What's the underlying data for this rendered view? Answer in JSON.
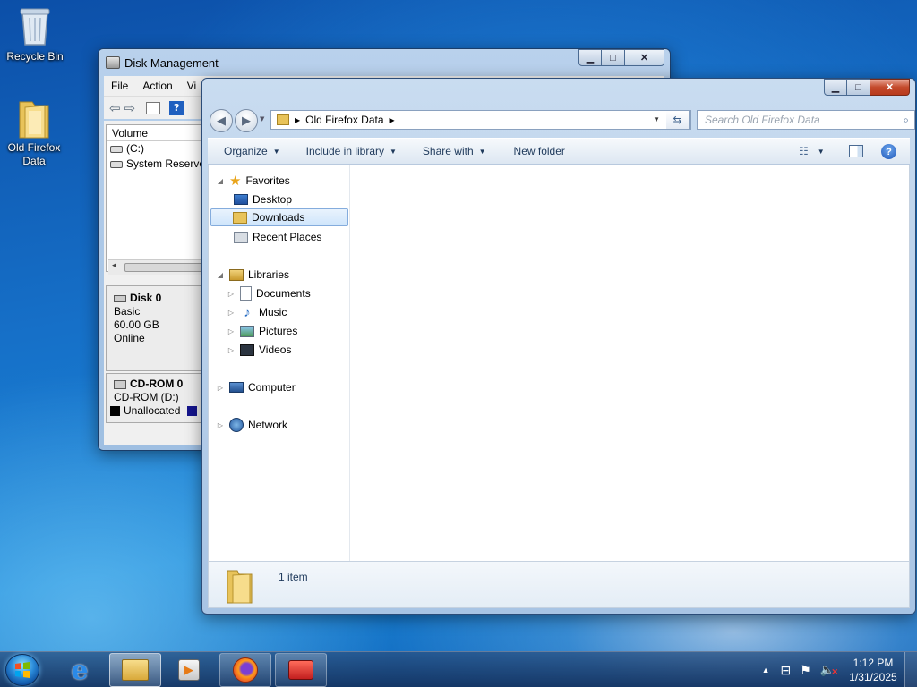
{
  "desktop": {
    "icons": [
      {
        "name": "recycle-bin",
        "label": "Recycle Bin"
      },
      {
        "name": "old-firefox-data",
        "label": "Old Firefox Data"
      }
    ]
  },
  "disk_management": {
    "title": "Disk Management",
    "menu": [
      "File",
      "Action",
      "Vi"
    ],
    "volume_header": "Volume",
    "volumes": [
      "(C:)",
      "System Reserved"
    ],
    "disk0": {
      "name": "Disk 0",
      "type": "Basic",
      "size": "60.00 GB",
      "status": "Online"
    },
    "cdrom0": {
      "name": "CD-ROM 0",
      "drive": "CD-ROM (D:)",
      "legend": "Unallocated"
    }
  },
  "explorer": {
    "address_path": "Old Firefox Data",
    "search_placeholder": "Search Old Firefox Data",
    "commands": {
      "organize": "Organize",
      "include": "Include in library",
      "share": "Share with",
      "new_folder": "New folder"
    },
    "nav": {
      "favorites": "Favorites",
      "desktop": "Desktop",
      "downloads": "Downloads",
      "recent": "Recent Places",
      "libraries": "Libraries",
      "documents": "Documents",
      "music": "Music",
      "pictures": "Pictures",
      "videos": "Videos",
      "computer": "Computer",
      "network": "Network"
    },
    "item_count": "1 item"
  },
  "taskbar": {
    "time": "1:12 PM",
    "date": "1/31/2025"
  },
  "colors": {
    "selection": "#cfe5fb",
    "accent": "#1e395b"
  }
}
